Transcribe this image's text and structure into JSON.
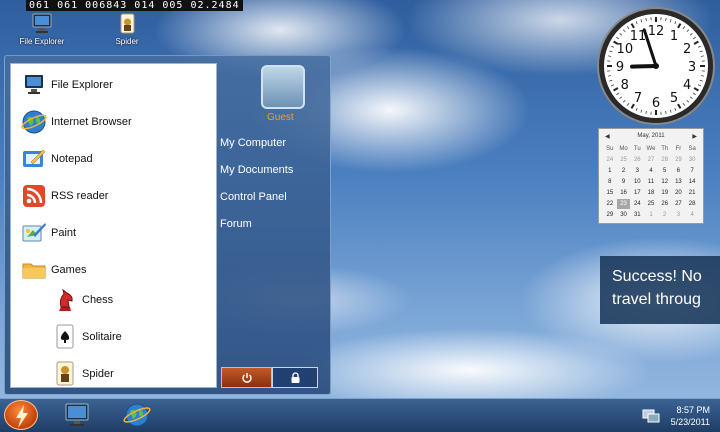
{
  "status_bar": {
    "text": "061 061 006843 014 005 02.2484"
  },
  "desktop_icons": [
    {
      "label": "File Explorer",
      "icon": "computer-icon"
    },
    {
      "label": "Spider",
      "icon": "spider-card-icon"
    }
  ],
  "start_menu": {
    "programs": [
      {
        "label": "File Explorer",
        "icon": "computer-icon"
      },
      {
        "label": "Internet Browser",
        "icon": "globe-icon"
      },
      {
        "label": "Notepad",
        "icon": "notepad-icon"
      },
      {
        "label": "RSS reader",
        "icon": "rss-icon"
      },
      {
        "label": "Paint",
        "icon": "paint-icon"
      },
      {
        "label": "Games",
        "icon": "folder-icon"
      }
    ],
    "games": [
      {
        "label": "Chess",
        "icon": "chess-knight-icon"
      },
      {
        "label": "Solitaire",
        "icon": "spade-card-icon"
      },
      {
        "label": "Spider",
        "icon": "spider-card-icon"
      }
    ],
    "user_name": "Guest",
    "links": [
      "My Computer",
      "My Documents",
      "Control Panel",
      "Forum"
    ],
    "power_icon": "power-icon",
    "lock_icon": "lock-icon"
  },
  "calendar": {
    "month_label": "May, 2011",
    "weekdays": [
      "Su",
      "Mo",
      "Tu",
      "We",
      "Th",
      "Fr",
      "Sa"
    ],
    "weeks": [
      [
        "24",
        "25",
        "26",
        "27",
        "28",
        "29",
        "30"
      ],
      [
        "1",
        "2",
        "3",
        "4",
        "5",
        "6",
        "7"
      ],
      [
        "8",
        "9",
        "10",
        "11",
        "12",
        "13",
        "14"
      ],
      [
        "15",
        "16",
        "17",
        "18",
        "19",
        "20",
        "21"
      ],
      [
        "22",
        "23",
        "24",
        "25",
        "26",
        "27",
        "28"
      ],
      [
        "29",
        "30",
        "31",
        "1",
        "2",
        "3",
        "4"
      ]
    ],
    "today": "23"
  },
  "clock": {
    "hour": 8,
    "minute": 57
  },
  "banner": {
    "line1": "Success! No",
    "line2": "travel throug"
  },
  "taskbar": {
    "time": "8:57 PM",
    "date": "5/23/2011",
    "pinned": [
      "monitor-icon",
      "globe-icon"
    ]
  },
  "colors": {
    "accent_orange": "#ff9a1a",
    "taskbar": "#1f3d66"
  }
}
